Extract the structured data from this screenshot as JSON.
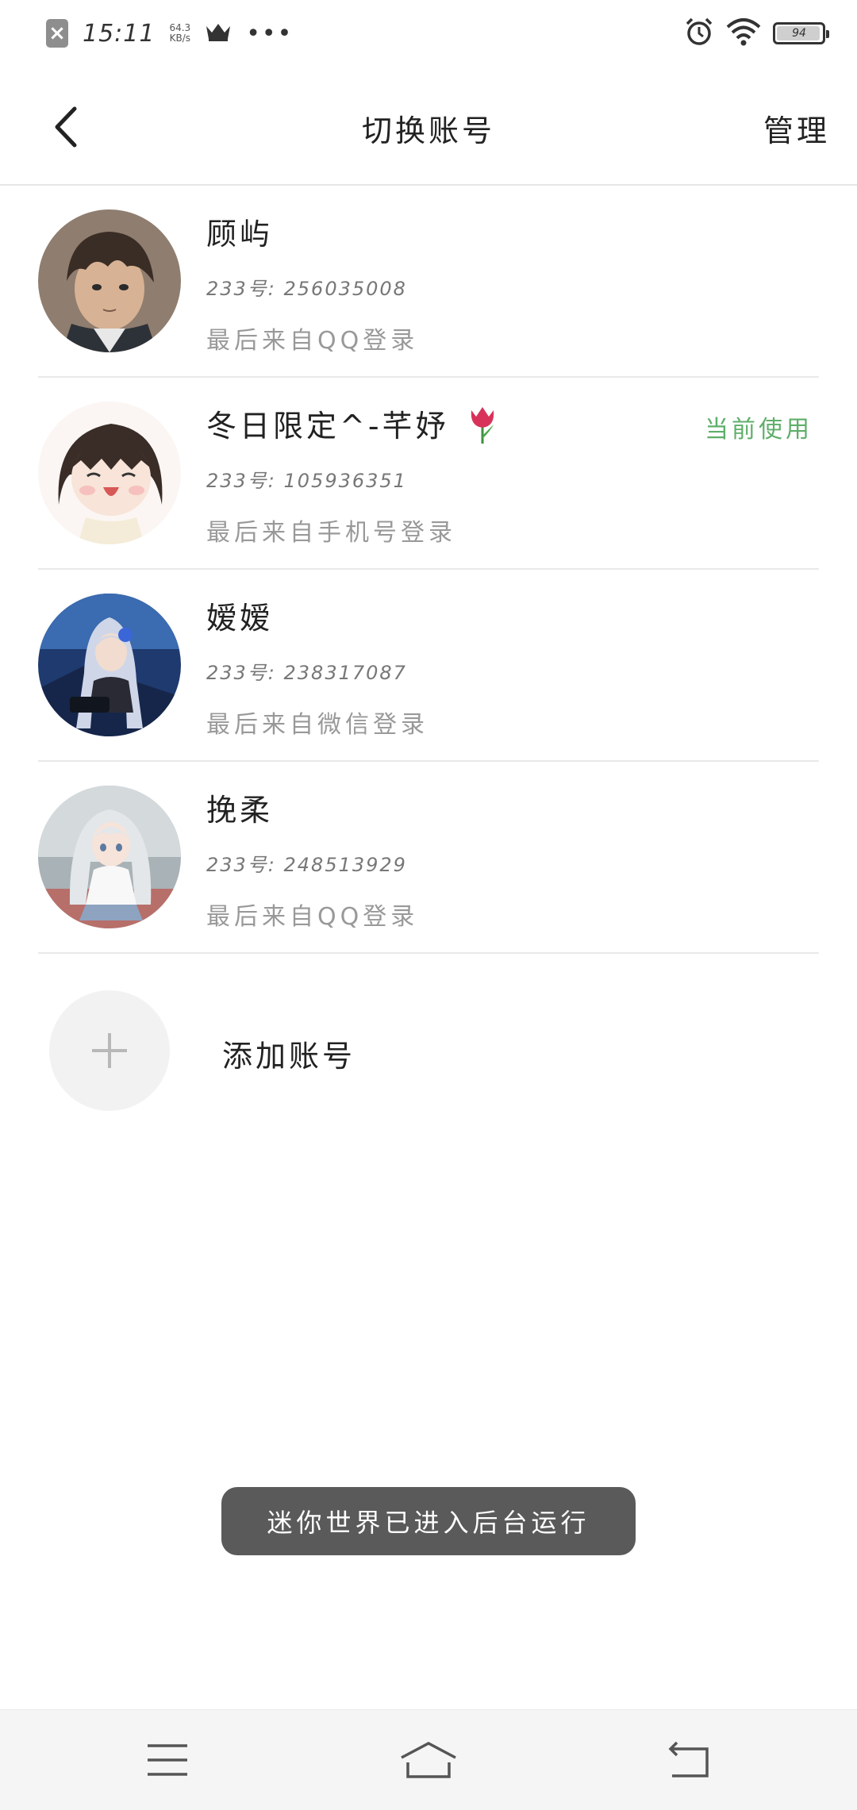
{
  "status_bar": {
    "time": "15:11",
    "net_speed_value": "64.3",
    "net_speed_unit": "KB/s",
    "battery_level": "94",
    "icons": [
      "close-notification-icon",
      "crown-icon",
      "more-dots-icon",
      "alarm-icon",
      "wifi-icon",
      "battery-icon"
    ],
    "more_dots": "•••"
  },
  "header": {
    "title": "切换账号",
    "manage_label": "管理",
    "back_icon": "chevron-left-icon"
  },
  "accounts": [
    {
      "name": "顾屿",
      "uid": "233号: 256035008",
      "source": "最后来自QQ登录",
      "current": false
    },
    {
      "name": "冬日限定^-芊妤",
      "uid": "233号: 105936351",
      "source": "最后来自手机号登录",
      "current": true,
      "current_label": "当前使用",
      "emoji": "tulip-icon"
    },
    {
      "name": "嫒嫒",
      "uid": "233号: 238317087",
      "source": "最后来自微信登录",
      "current": false
    },
    {
      "name": "挽柔",
      "uid": "233号: 248513929",
      "source": "最后来自QQ登录",
      "current": false
    }
  ],
  "add_account": {
    "label": "添加账号",
    "icon": "plus-icon"
  },
  "toast": {
    "text": "迷你世界已进入后台运行"
  },
  "nav_bar": {
    "icons": [
      "menu-icon",
      "home-icon",
      "back-icon"
    ]
  },
  "colors": {
    "accent_current": "#5fae6a",
    "toast_bg": "#5a5a5a",
    "divider": "#e9e9e9"
  }
}
